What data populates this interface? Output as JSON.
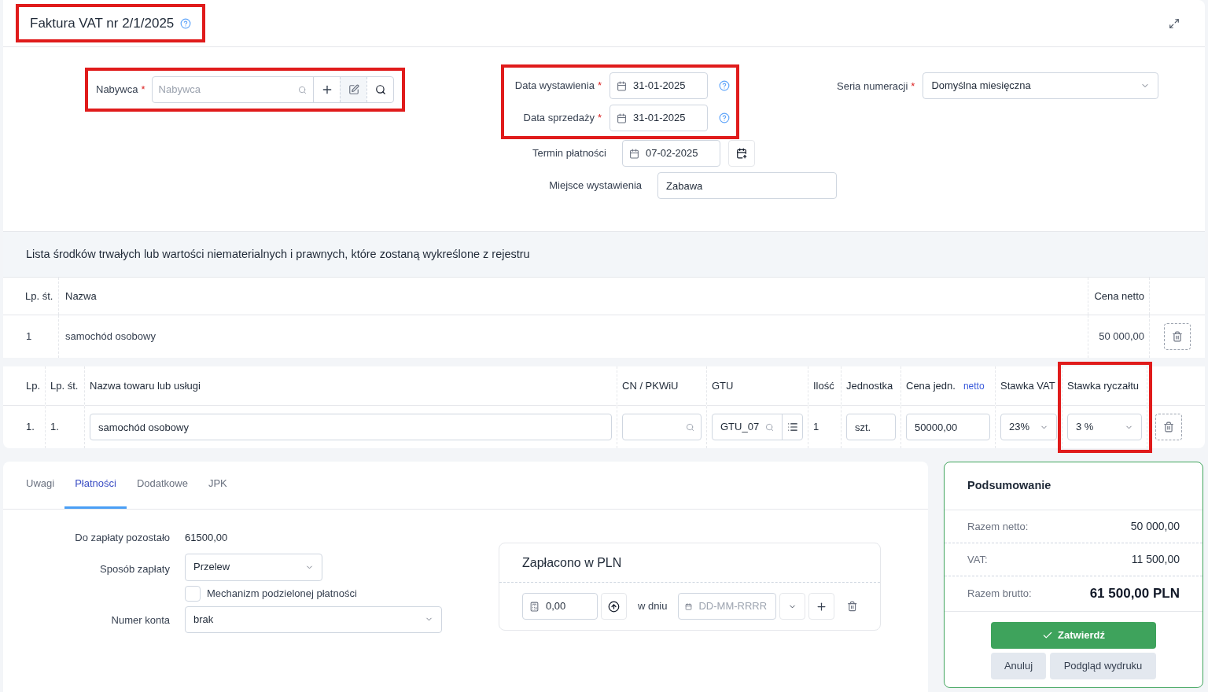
{
  "header": {
    "title": "Faktura VAT nr 2/1/2025",
    "highlighted": true
  },
  "buyer": {
    "label": "Nabywca",
    "required_mark": "*",
    "placeholder": "Nabywca",
    "highlighted": true
  },
  "date_group": {
    "highlighted": true,
    "fields": [
      {
        "label": "Data wystawienia",
        "required_mark": "*",
        "value": "31-01-2025"
      },
      {
        "label": "Data sprzedaży",
        "required_mark": "*",
        "value": "31-01-2025"
      }
    ]
  },
  "payment_due": {
    "label": "Termin płatności",
    "value": "07-02-2025"
  },
  "place": {
    "label": "Miejsce wystawienia",
    "value": "Zabawa"
  },
  "series": {
    "label": "Seria numeracji",
    "required_mark": "*",
    "value": "Domyślna miesięczna"
  },
  "assets": {
    "title": "Lista środków trwałych lub wartości niematerialnych i prawnych, które zostaną wykreślone z rejestru",
    "columns": [
      "Lp. śt.",
      "Nazwa",
      "Cena netto"
    ],
    "rows": [
      {
        "cells": [
          "1",
          "samochód osobowy",
          "50 000,00"
        ]
      }
    ]
  },
  "items": {
    "columns": [
      {
        "kind": "text",
        "label": "Lp.",
        "highlighted": false
      },
      {
        "kind": "text",
        "label": "Lp. śt.",
        "highlighted": false
      },
      {
        "kind": "input",
        "label": "Nazwa towaru lub usługi",
        "highlighted": false
      },
      {
        "kind": "search",
        "label": "CN / PKWiU",
        "highlighted": false
      },
      {
        "kind": "gtu",
        "label": "GTU",
        "highlighted": false
      },
      {
        "kind": "text",
        "label": "Ilość",
        "highlighted": false
      },
      {
        "kind": "input",
        "label": "Jednostka",
        "highlighted": false
      },
      {
        "kind": "input",
        "label": "Cena jedn.",
        "sub": "netto",
        "highlighted": false
      },
      {
        "kind": "select",
        "label": "Stawka VAT",
        "highlighted": false
      },
      {
        "kind": "select",
        "label": "Stawka ryczałtu",
        "highlighted": true
      },
      {
        "kind": "delete",
        "highlighted": false
      }
    ],
    "rows": [
      {
        "cells": [
          "1.",
          "1.",
          "samochód osobowy",
          null,
          "GTU_07",
          "1",
          "szt.",
          "50000,00",
          "23%",
          "3 %"
        ]
      }
    ]
  },
  "tabs": [
    {
      "label": "Uwagi",
      "selected": false
    },
    {
      "label": "Płatności",
      "selected": true
    },
    {
      "label": "Dodatkowe",
      "selected": false
    },
    {
      "label": "JPK",
      "selected": false
    }
  ],
  "payment": {
    "remaining_label": "Do zapłaty pozostało",
    "remaining_value": "61500,00",
    "method_label": "Sposób zapłaty",
    "method_value": "Przelew",
    "split": {
      "label": "Mechanizm podzielonej płatności",
      "checked": false
    },
    "account_label": "Numer konta",
    "account_value": "brak"
  },
  "paid": {
    "title": "Zapłacono w PLN",
    "amount": "0,00",
    "date_label": "w dniu",
    "date_placeholder": "DD-MM-RRRR"
  },
  "summary": {
    "title": "Podsumowanie",
    "rows": [
      {
        "label": "Razem netto:",
        "value": "50 000,00",
        "emphasis": false
      },
      {
        "label": "VAT:",
        "value": "11 500,00",
        "emphasis": false
      },
      {
        "label": "Razem brutto:",
        "value": "61 500,00 PLN",
        "emphasis": true
      }
    ],
    "confirm": "Zatwierdź",
    "cancel": "Anuluj",
    "preview": "Podgląd wydruku"
  }
}
